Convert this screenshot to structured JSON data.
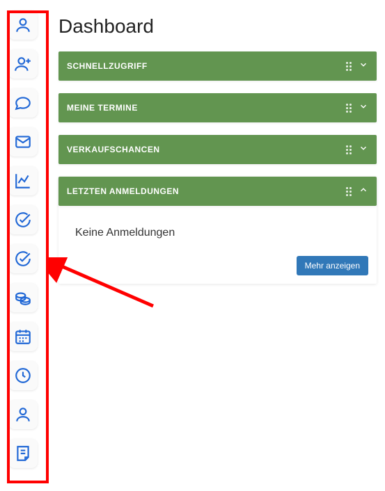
{
  "page_title": "Dashboard",
  "sidebar": {
    "items": [
      {
        "name": "user-icon"
      },
      {
        "name": "user-plus-icon"
      },
      {
        "name": "chat-icon"
      },
      {
        "name": "mail-icon"
      },
      {
        "name": "chart-line-icon"
      },
      {
        "name": "check-circle-icon"
      },
      {
        "name": "check-circle-icon"
      },
      {
        "name": "coins-icon"
      },
      {
        "name": "calendar-icon"
      },
      {
        "name": "clock-icon"
      },
      {
        "name": "user-icon"
      },
      {
        "name": "note-icon"
      }
    ]
  },
  "panels": [
    {
      "title": "SCHNELLZUGRIFF",
      "expanded": false
    },
    {
      "title": "MEINE TERMINE",
      "expanded": false
    },
    {
      "title": "VERKAUFSCHANCEN",
      "expanded": false
    },
    {
      "title": "LETZTEN ANMELDUNGEN",
      "expanded": true,
      "empty_text": "Keine Anmeldungen",
      "more_label": "Mehr anzeigen"
    }
  ],
  "annotation": {
    "highlight": "sidebar",
    "arrow_color": "#ff0000"
  }
}
